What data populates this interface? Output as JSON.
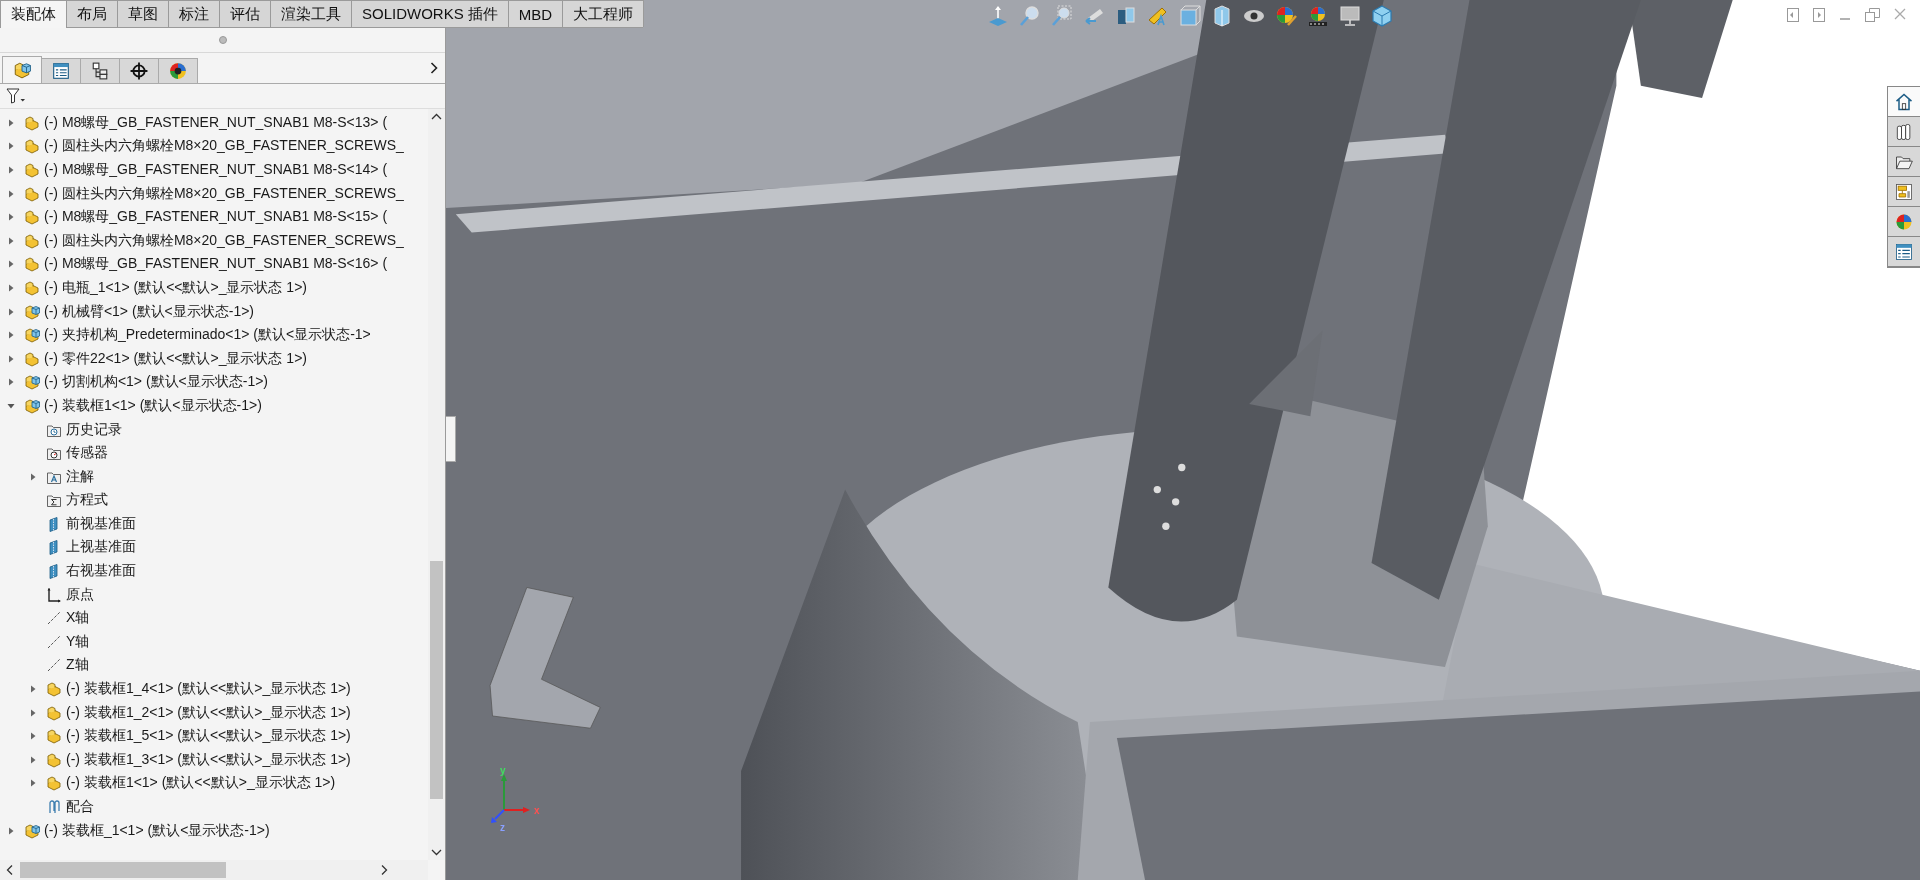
{
  "command_tabs": [
    {
      "label": "装配体",
      "selected": true
    },
    {
      "label": "布局",
      "selected": false
    },
    {
      "label": "草图",
      "selected": false
    },
    {
      "label": "标注",
      "selected": false
    },
    {
      "label": "评估",
      "selected": false
    },
    {
      "label": "渲染工具",
      "selected": false
    },
    {
      "label": "SOLIDWORKS 插件",
      "selected": false
    },
    {
      "label": "MBD",
      "selected": false
    },
    {
      "label": "大工程师",
      "selected": false
    }
  ],
  "panel_tabs": [
    {
      "kind": "feature-manager",
      "selected": true
    },
    {
      "kind": "property-manager",
      "selected": false
    },
    {
      "kind": "configuration-manager",
      "selected": false
    },
    {
      "kind": "dimxpert",
      "selected": false
    },
    {
      "kind": "display-manager",
      "selected": false
    }
  ],
  "tree": {
    "items": [
      {
        "kind": "part",
        "text": "(-) M8螺母_GB_FASTENER_NUT_SNAB1 M8-S<13> (",
        "expanded": false
      },
      {
        "kind": "part",
        "text": "(-) 圆柱头内六角螺栓M8×20_GB_FASTENER_SCREWS_",
        "expanded": false
      },
      {
        "kind": "part",
        "text": "(-) M8螺母_GB_FASTENER_NUT_SNAB1 M8-S<14> (",
        "expanded": false
      },
      {
        "kind": "part",
        "text": "(-) 圆柱头内六角螺栓M8×20_GB_FASTENER_SCREWS_",
        "expanded": false
      },
      {
        "kind": "part",
        "text": "(-) M8螺母_GB_FASTENER_NUT_SNAB1 M8-S<15> (",
        "expanded": false
      },
      {
        "kind": "part",
        "text": "(-) 圆柱头内六角螺栓M8×20_GB_FASTENER_SCREWS_",
        "expanded": false
      },
      {
        "kind": "part",
        "text": "(-) M8螺母_GB_FASTENER_NUT_SNAB1 M8-S<16> (",
        "expanded": false
      },
      {
        "kind": "part",
        "text": "(-) 电瓶_1<1> (默认<<默认>_显示状态 1>)",
        "expanded": false
      },
      {
        "kind": "assembly",
        "text": "(-) 机械臂<1> (默认<显示状态-1>)",
        "expanded": false
      },
      {
        "kind": "assembly",
        "text": "(-) 夹持机构_Predeterminado<1> (默认<显示状态-1>",
        "expanded": false
      },
      {
        "kind": "part",
        "text": "(-) 零件22<1> (默认<<默认>_显示状态 1>)",
        "expanded": false
      },
      {
        "kind": "assembly",
        "text": "(-) 切割机构<1> (默认<显示状态-1>)",
        "expanded": false
      },
      {
        "kind": "assembly",
        "text": "(-) 装载框1<1> (默认<显示状态-1>)",
        "expanded": true,
        "children": [
          {
            "kind": "history",
            "text": "历史记录"
          },
          {
            "kind": "sensor",
            "text": "传感器"
          },
          {
            "kind": "annotation",
            "text": "注解",
            "expanded": false
          },
          {
            "kind": "equation",
            "text": "方程式"
          },
          {
            "kind": "plane",
            "text": "前视基准面"
          },
          {
            "kind": "plane",
            "text": "上视基准面"
          },
          {
            "kind": "plane",
            "text": "右视基准面"
          },
          {
            "kind": "origin",
            "text": "原点"
          },
          {
            "kind": "axis",
            "text": "X轴"
          },
          {
            "kind": "axis",
            "text": "Y轴"
          },
          {
            "kind": "axis",
            "text": "Z轴"
          },
          {
            "kind": "part",
            "text": "(-) 装载框1_4<1> (默认<<默认>_显示状态 1>)",
            "expanded": false
          },
          {
            "kind": "part",
            "text": "(-) 装载框1_2<1> (默认<<默认>_显示状态 1>)",
            "expanded": false
          },
          {
            "kind": "part",
            "text": "(-) 装载框1_5<1> (默认<<默认>_显示状态 1>)",
            "expanded": false
          },
          {
            "kind": "part",
            "text": "(-) 装载框1_3<1> (默认<<默认>_显示状态 1>)",
            "expanded": false
          },
          {
            "kind": "part",
            "text": "(-) 装载框1<1> (默认<<默认>_显示状态 1>)",
            "expanded": false
          },
          {
            "kind": "mates",
            "text": "配合"
          }
        ]
      },
      {
        "kind": "assembly",
        "text": "(-) 装载框_1<1> (默认<显示状态-1>)",
        "expanded": false
      }
    ]
  },
  "axis_labels": [
    "y",
    "x",
    "z"
  ],
  "task_pane_tabs": [
    {
      "kind": "home",
      "selected": true
    },
    {
      "kind": "library",
      "selected": false
    },
    {
      "kind": "folder",
      "selected": false
    },
    {
      "kind": "palette",
      "selected": false
    },
    {
      "kind": "appearances",
      "selected": false
    },
    {
      "kind": "properties",
      "selected": false
    }
  ]
}
